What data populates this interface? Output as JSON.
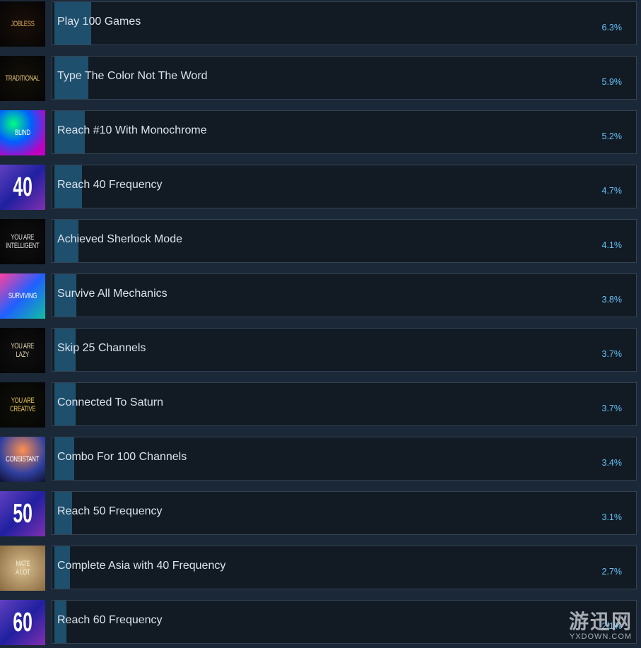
{
  "achievements": [
    {
      "name": "Play 100 Games",
      "percent": "6.3%",
      "percent_value": 6.3,
      "icon_label": "JOBLESS",
      "icon_name": "jobless-icon",
      "icon_bg": "#050505",
      "icon_fg": "#d8a45c"
    },
    {
      "name": "Type The Color Not The Word",
      "percent": "5.9%",
      "percent_value": 5.9,
      "icon_label": "TRADITIONAL",
      "icon_name": "traditional-icon",
      "icon_bg": "#060606",
      "icon_fg": "#e0c07a"
    },
    {
      "name": "Reach #10 With Monochrome",
      "percent": "5.2%",
      "percent_value": 5.2,
      "icon_label": "BLIND",
      "icon_name": "blind-icon",
      "icon_bg": "#2a3a7a",
      "icon_fg": "#ffffff"
    },
    {
      "name": "Reach 40 Frequency",
      "percent": "4.7%",
      "percent_value": 4.7,
      "icon_label": "40",
      "icon_name": "frequency-40-icon",
      "icon_bg": "#4a3aa0",
      "icon_fg": "#ffffff"
    },
    {
      "name": "Achieved Sherlock Mode",
      "percent": "4.1%",
      "percent_value": 4.1,
      "icon_label": "YOU ARE\nINTELLIGENT",
      "icon_name": "intelligent-icon",
      "icon_bg": "#050505",
      "icon_fg": "#dcdcdc"
    },
    {
      "name": "Survive All Mechanics",
      "percent": "3.8%",
      "percent_value": 3.8,
      "icon_label": "SURVIVING",
      "icon_name": "surviving-icon",
      "icon_bg": "#3a1f6a",
      "icon_fg": "#ffffff"
    },
    {
      "name": "Skip 25 Channels",
      "percent": "3.7%",
      "percent_value": 3.7,
      "icon_label": "YOU ARE\nLAZY",
      "icon_name": "lazy-icon",
      "icon_bg": "#050505",
      "icon_fg": "#e0d4b0"
    },
    {
      "name": "Connected To Saturn",
      "percent": "3.7%",
      "percent_value": 3.7,
      "icon_label": "YOU ARE\nCREATIVE",
      "icon_name": "creative-icon",
      "icon_bg": "#050505",
      "icon_fg": "#e0c05a"
    },
    {
      "name": "Combo For 100 Channels",
      "percent": "3.4%",
      "percent_value": 3.4,
      "icon_label": "CONSISTANT",
      "icon_name": "consistant-icon",
      "icon_bg": "#1a2a6a",
      "icon_fg": "#ffffff"
    },
    {
      "name": "Reach 50 Frequency",
      "percent": "3.1%",
      "percent_value": 3.1,
      "icon_label": "50",
      "icon_name": "frequency-50-icon",
      "icon_bg": "#3a30a0",
      "icon_fg": "#ffffff"
    },
    {
      "name": "Complete Asia with 40 Frequency",
      "percent": "2.7%",
      "percent_value": 2.7,
      "icon_label": "MATE\nA LOT",
      "icon_name": "mate-a-lot-icon",
      "icon_bg": "#b89a6a",
      "icon_fg": "#f4ead0"
    },
    {
      "name": "Reach 60 Frequency",
      "percent": "2.1%",
      "percent_value": 2.1,
      "icon_label": "60",
      "icon_name": "frequency-60-icon",
      "icon_bg": "#3a30a0",
      "icon_fg": "#ffffff"
    }
  ],
  "watermark": {
    "main": "游迅网",
    "sub": "YXDOWN.COM"
  }
}
